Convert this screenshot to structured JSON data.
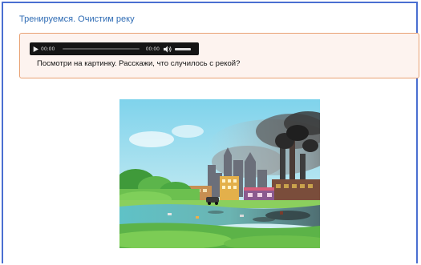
{
  "page": {
    "title": "Тренируемся. Очистим реку"
  },
  "task": {
    "audio": {
      "current_time": "00:00",
      "duration": "00:00",
      "play_icon": "play-icon",
      "volume_icon": "volume-icon"
    },
    "question": "Посмотри на картинку. Расскажи, что случилось с рекой?"
  },
  "picture": {
    "subject": "polluted-river-illustration"
  },
  "colors": {
    "frame_border": "#4a6fd1",
    "title_text": "#2f6cb5",
    "task_border": "#e8a173",
    "task_bg": "#fdf3ef",
    "player_bg": "#151515"
  }
}
